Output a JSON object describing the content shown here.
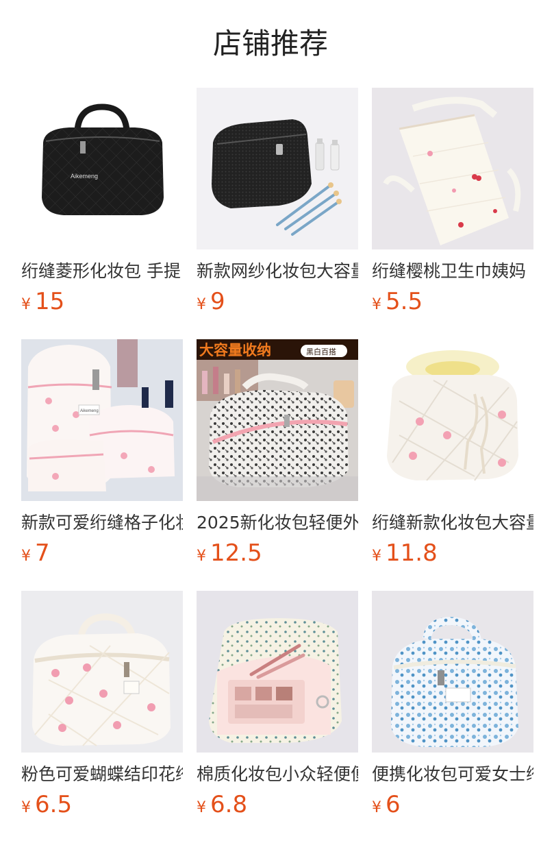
{
  "page": {
    "title": "店铺推荐"
  },
  "currency_symbol": "¥",
  "products": [
    {
      "name": "绗缝菱形化妆包 手提",
      "price": "15",
      "image_text": "Aikemeng"
    },
    {
      "name": "新款网纱化妆包大容量",
      "price": "9"
    },
    {
      "name": "绗缝樱桃卫生巾姨妈",
      "price": "5.5"
    },
    {
      "name": "新款可爱绗缝格子化妆",
      "price": "7",
      "image_text": "Aikemeng"
    },
    {
      "name": "2025新化妆包轻便外",
      "price": "12.5",
      "image_banner": "大容量收纳",
      "image_badge": "黑白百搭"
    },
    {
      "name": "绗缝新款化妆包大容量",
      "price": "11.8"
    },
    {
      "name": "粉色可爱蝴蝶结印花绗",
      "price": "6.5"
    },
    {
      "name": "棉质化妆包小众轻便便",
      "price": "6.8"
    },
    {
      "name": "便携化妆包可爱女士绗",
      "price": "6"
    }
  ],
  "colors": {
    "price": "#e4501a",
    "title": "#222222",
    "text": "#333333"
  }
}
